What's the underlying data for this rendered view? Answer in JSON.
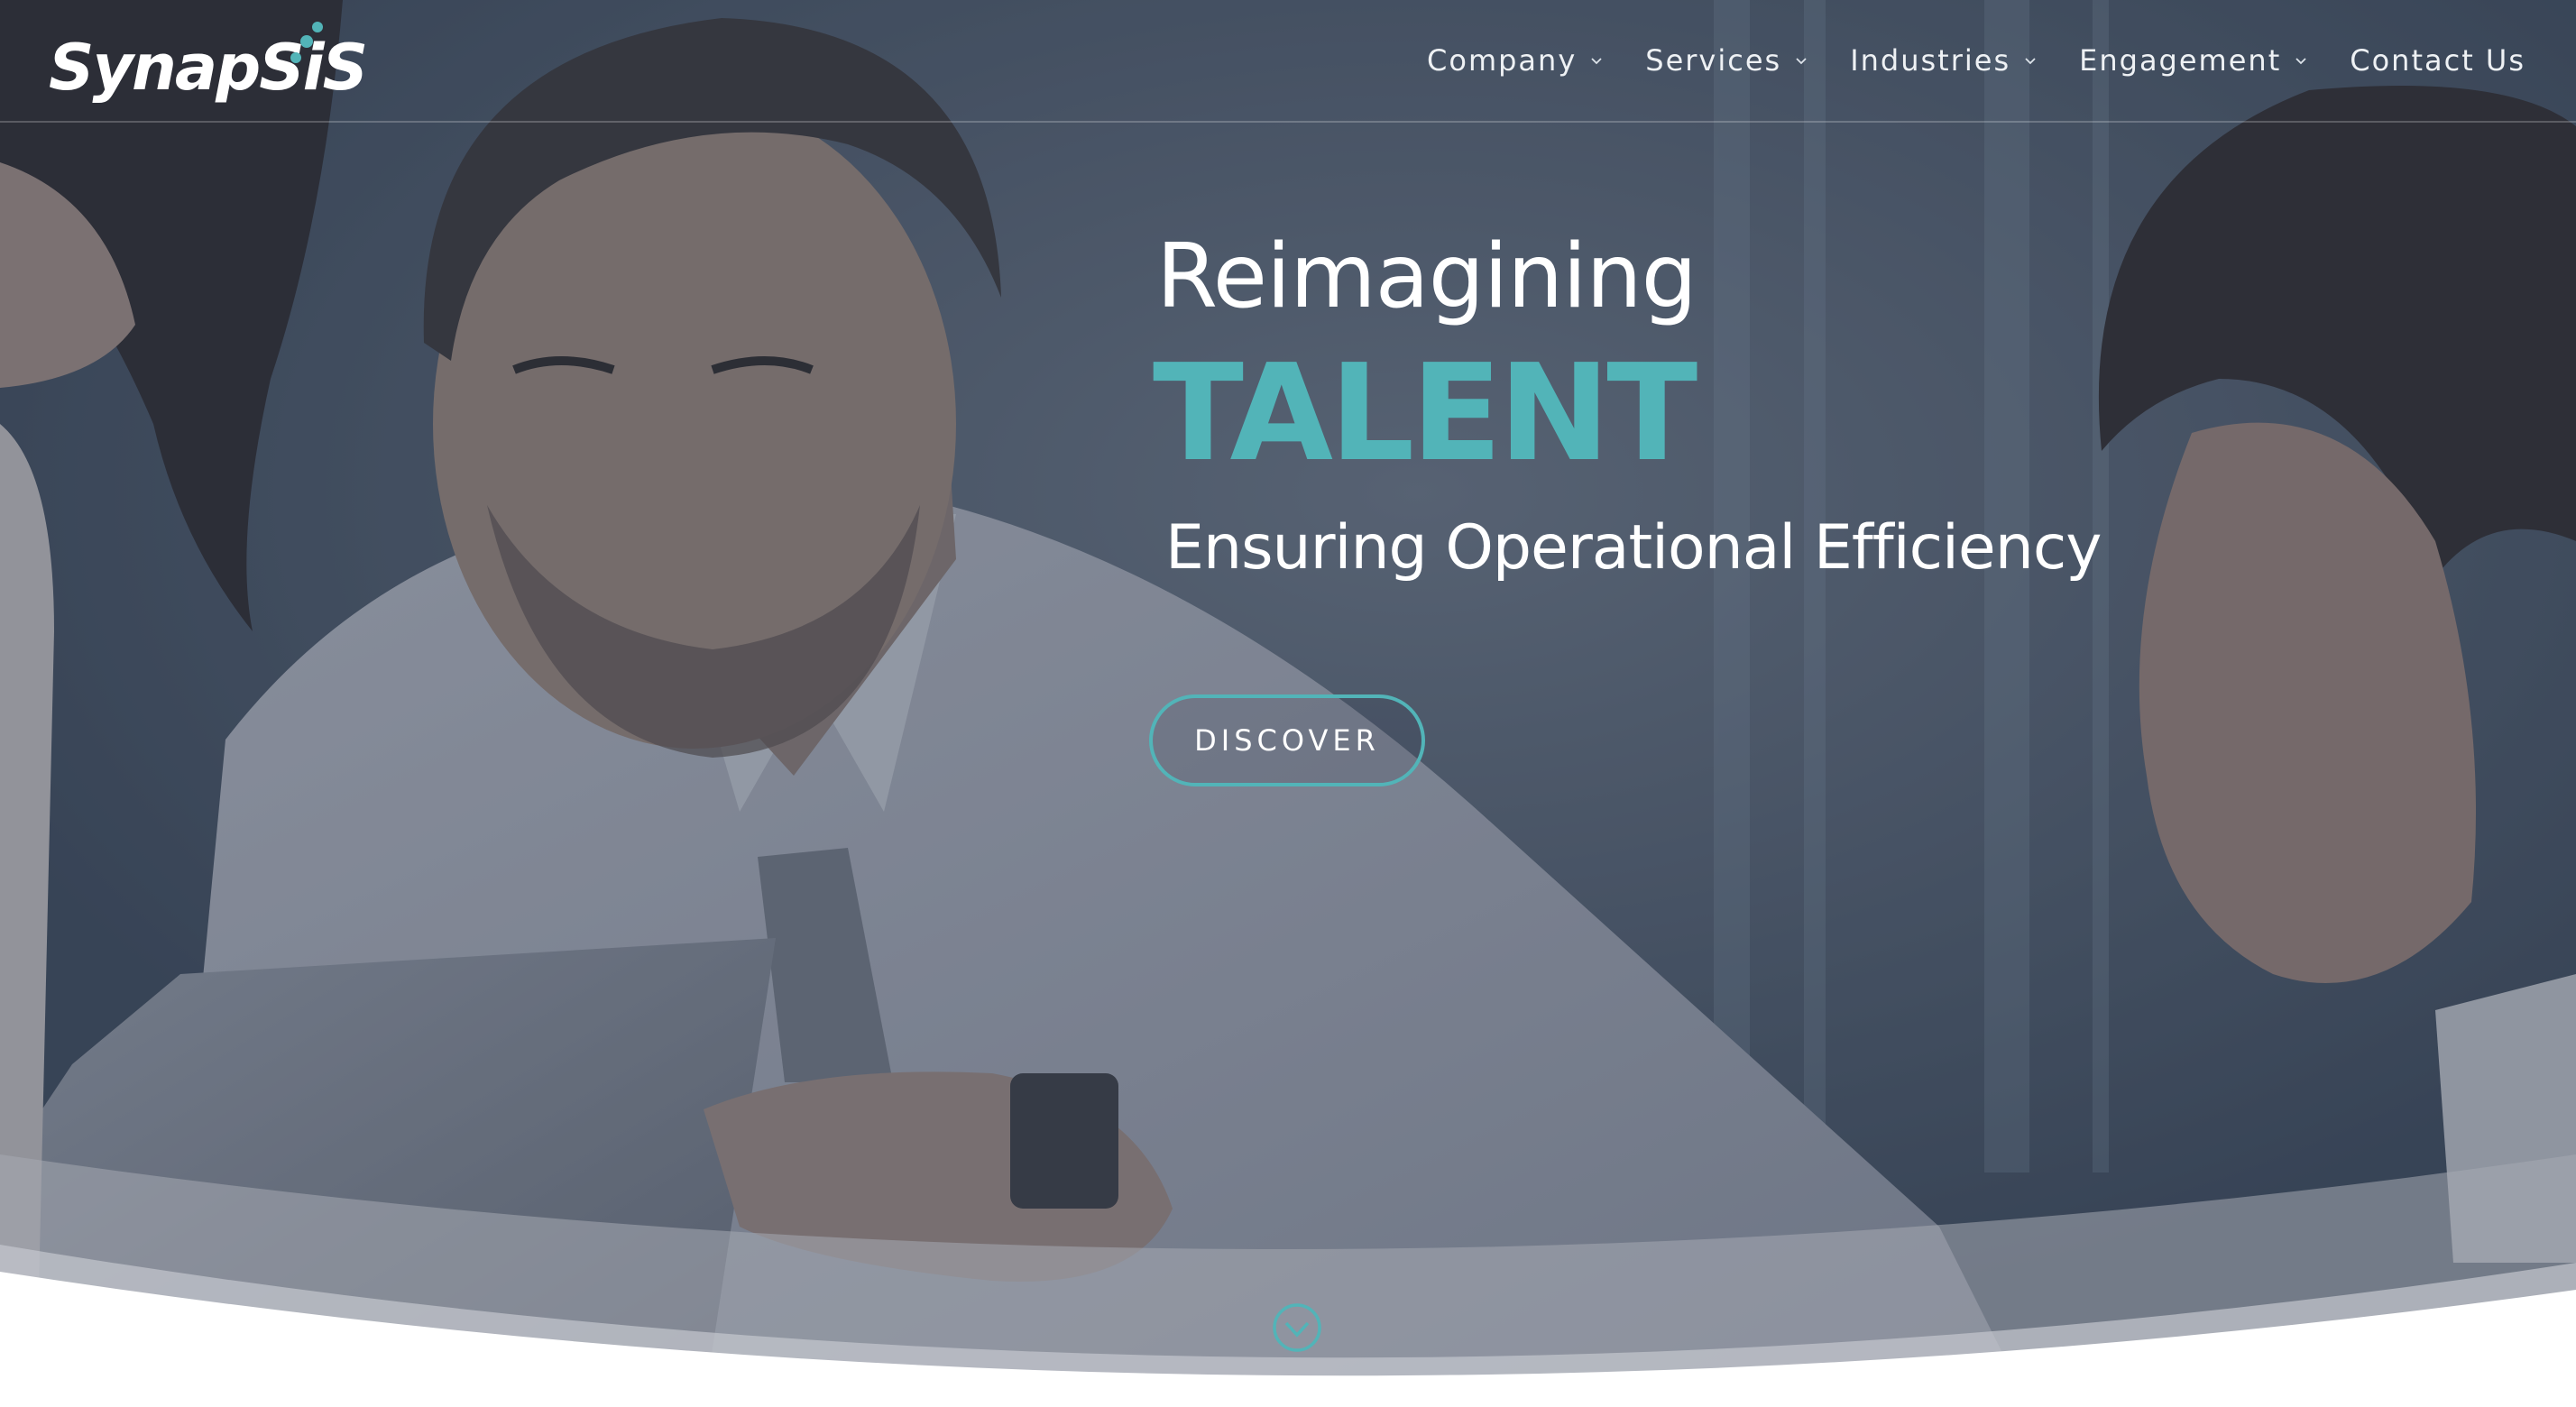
{
  "brand": {
    "logo_text": "SynapSiS"
  },
  "nav": {
    "items": [
      {
        "label": "Company",
        "has_dropdown": true
      },
      {
        "label": "Services",
        "has_dropdown": true
      },
      {
        "label": "Industries",
        "has_dropdown": true
      },
      {
        "label": "Engagement",
        "has_dropdown": true
      },
      {
        "label": "Contact Us",
        "has_dropdown": false
      }
    ]
  },
  "hero": {
    "pre_heading": "Reimagining",
    "heading": "TALENT",
    "subheading": "Ensuring Operational Efficiency",
    "cta_label": "DISCOVER"
  },
  "icons": {
    "nav_caret": "chevron-down-icon",
    "scroll": "circle-chevron-down-icon",
    "logo_dots": "dots-icon"
  },
  "colors": {
    "accent": "#52b4b8",
    "text_light": "#ffffff",
    "overlay": "#2d3a4e"
  }
}
